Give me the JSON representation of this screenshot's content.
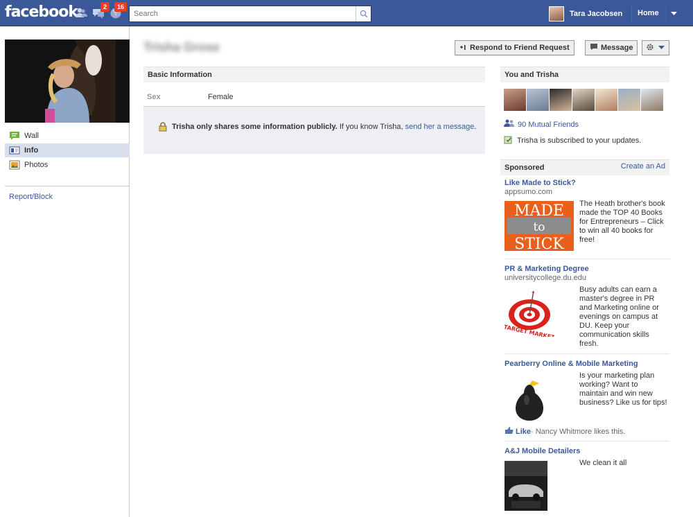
{
  "topbar": {
    "logo": "facebook",
    "friend_requests_badge": "",
    "messages_badge": "2",
    "notifications_badge": "16",
    "search_placeholder": "Search",
    "user_name": "Tara Jacobsen",
    "home_label": "Home"
  },
  "sidebar": {
    "items": [
      {
        "label": "Wall",
        "icon": "wall-icon"
      },
      {
        "label": "Info",
        "icon": "info-icon",
        "active": true
      },
      {
        "label": "Photos",
        "icon": "photos-icon"
      }
    ],
    "report_label": "Report/Block"
  },
  "profile": {
    "name": "Trisha Grose",
    "buttons": {
      "respond": "Respond to Friend Request",
      "message": "Message"
    },
    "basic_info_header": "Basic Information",
    "sex_label": "Sex",
    "sex_value": "Female",
    "notice_bold": "Trisha only shares some information publicly.",
    "notice_text": " If you know Trisha, ",
    "notice_link": "send her a message",
    "notice_end": "."
  },
  "right": {
    "you_and_header": "You and Trisha",
    "mutual_friends": "90 Mutual Friends",
    "subscribed": "Trisha is subscribed to your updates.",
    "sponsored_header": "Sponsored",
    "create_ad": "Create an Ad",
    "ads": [
      {
        "title": "Like Made to Stick?",
        "domain": "appsumo.com",
        "body": "The Heath brother's book made the TOP 40 Books for Entrepreneurs – Click to win all 40 books for free!",
        "image_text": [
          "MADE",
          "to",
          "STICK"
        ]
      },
      {
        "title": "PR & Marketing Degree",
        "domain": "universitycollege.du.edu",
        "body": "Busy adults can earn a master's degree in PR and Marketing online or evenings on campus at DU. Keep your communication skills fresh.",
        "image_text": "TARGET MARKET"
      },
      {
        "title": "Pearberry Online & Mobile Marketing",
        "domain": "",
        "body": "Is your marketing plan working? Want to maintain and win new business? Like us for tips!",
        "like_label": "Like",
        "like_text": "· Nancy Whitmore likes this."
      },
      {
        "title": "A&J Mobile Detailers",
        "domain": "",
        "body": "We clean it all"
      }
    ]
  },
  "colors": {
    "brand_blue": "#3b5998",
    "badge_red": "#f03d25",
    "highlight": "#d8dfea"
  }
}
